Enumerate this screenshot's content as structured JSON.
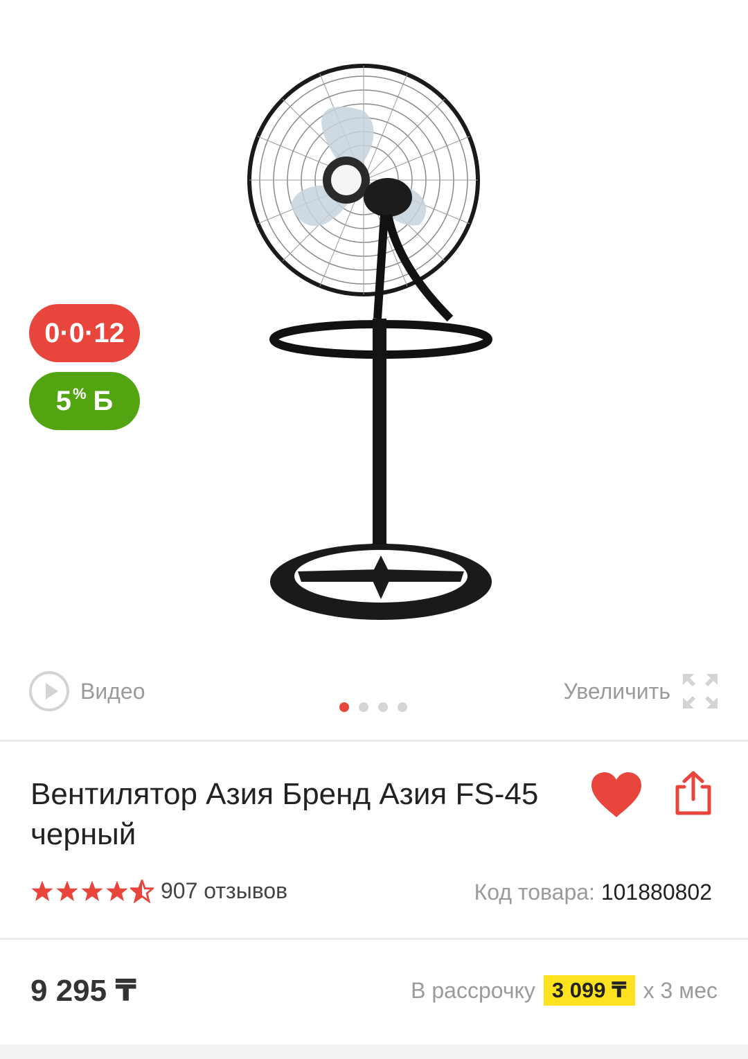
{
  "gallery": {
    "badge_installment": "0·0·12",
    "badge_bonus": {
      "value": "5",
      "percent": "%",
      "currency": "Б"
    },
    "video_label": "Видео",
    "zoom_label": "Увеличить",
    "pagination": {
      "total": 4,
      "active": 1
    }
  },
  "product": {
    "title": "Вентилятор Азия Бренд Азия FS-45 черный",
    "rating": 4.5,
    "reviews_label": "907 отзывов",
    "sku_label": "Код товара:",
    "sku_value": "101880802",
    "price": "9 295 ₸",
    "installment_prefix": "В рассрочку",
    "installment_amount": "3 099 ₸",
    "installment_suffix": "x 3 мес"
  },
  "colors": {
    "accent_red": "#e8463d",
    "bonus_green": "#52a410",
    "installment_highlight": "#ffe21f"
  },
  "icons": {
    "video": "play-circle-icon",
    "zoom": "expand-icon",
    "favorite": "heart-icon",
    "share": "share-icon",
    "rating": "star-icon"
  }
}
